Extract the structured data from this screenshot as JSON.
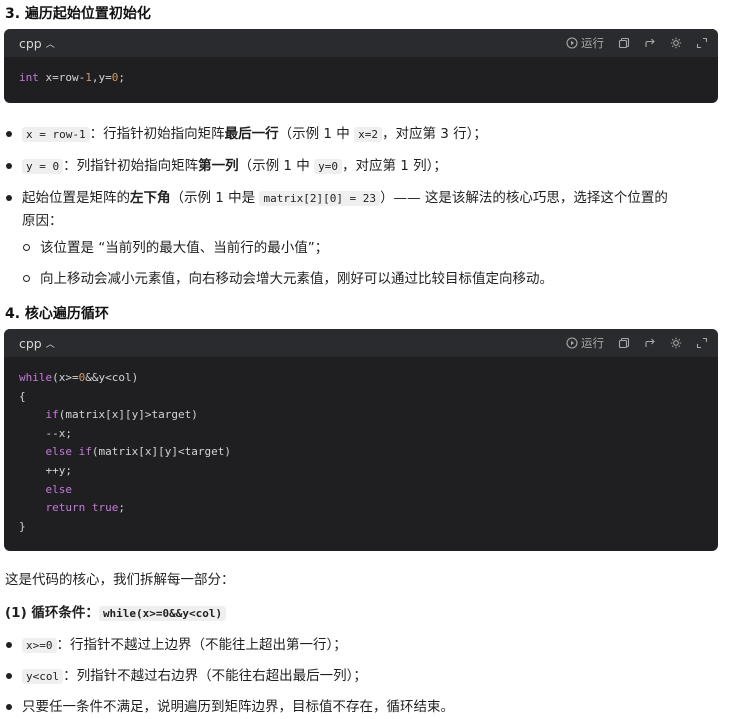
{
  "sections": {
    "s3": {
      "title": "3. 遍历起始位置初始化"
    },
    "s4": {
      "title": "4. 核心遍历循环"
    }
  },
  "code_toolbar": {
    "lang": "cpp",
    "run_label": "运行"
  },
  "code1": {
    "lines": [
      "int x=row-1,y=0;"
    ]
  },
  "code2": {
    "lines": [
      "while(x>=0&&y<col)",
      "{",
      "    if(matrix[x][y]>target)",
      "    --x;",
      "    else if(matrix[x][y]<target)",
      "    ++y;",
      "    else",
      "    return true;",
      "}"
    ]
  },
  "bullets1": [
    {
      "code": "x = row-1",
      "pre": "：行指针初始指向矩阵",
      "bold": "最后一行",
      "mid": "（示例 1 中 ",
      "code2": "x=2",
      "post": "，对应第 3 行）；"
    },
    {
      "code": "y = 0",
      "pre": "：列指针初始指向矩阵",
      "bold": "第一列",
      "mid": "（示例 1 中 ",
      "code2": "y=0",
      "post": "，对应第 1 列）；"
    },
    {
      "pre": "起始位置是矩阵的",
      "bold": "左下角",
      "mid": "（示例 1 中是 ",
      "code": "matrix[2][0] = 23",
      "post": "）—— 这是该解法的核心巧思，选择这个位置的",
      "cont": "原因："
    }
  ],
  "sub_bullets": [
    "该位置是 “当前列的最大值、当前行的最小值”；",
    "向上移动会减小元素值，向右移动会增大元素值，刚好可以通过比较目标值定向移动。"
  ],
  "para": "这是代码的核心，我们拆解每一部分：",
  "sub_heading": {
    "label": "(1) 循环条件：",
    "code": "while(x>=0&&y<col)"
  },
  "bullets2": [
    {
      "code": "x>=0",
      "text": "：行指针不越过上边界（不能往上超出第一行）；"
    },
    {
      "code": "y<col",
      "text": "：列指针不越过右边界（不能往右超出最后一列）；"
    },
    {
      "text": "只要任一条件不满足，说明遍历到矩阵边界，目标值不存在，循环结束。"
    }
  ]
}
